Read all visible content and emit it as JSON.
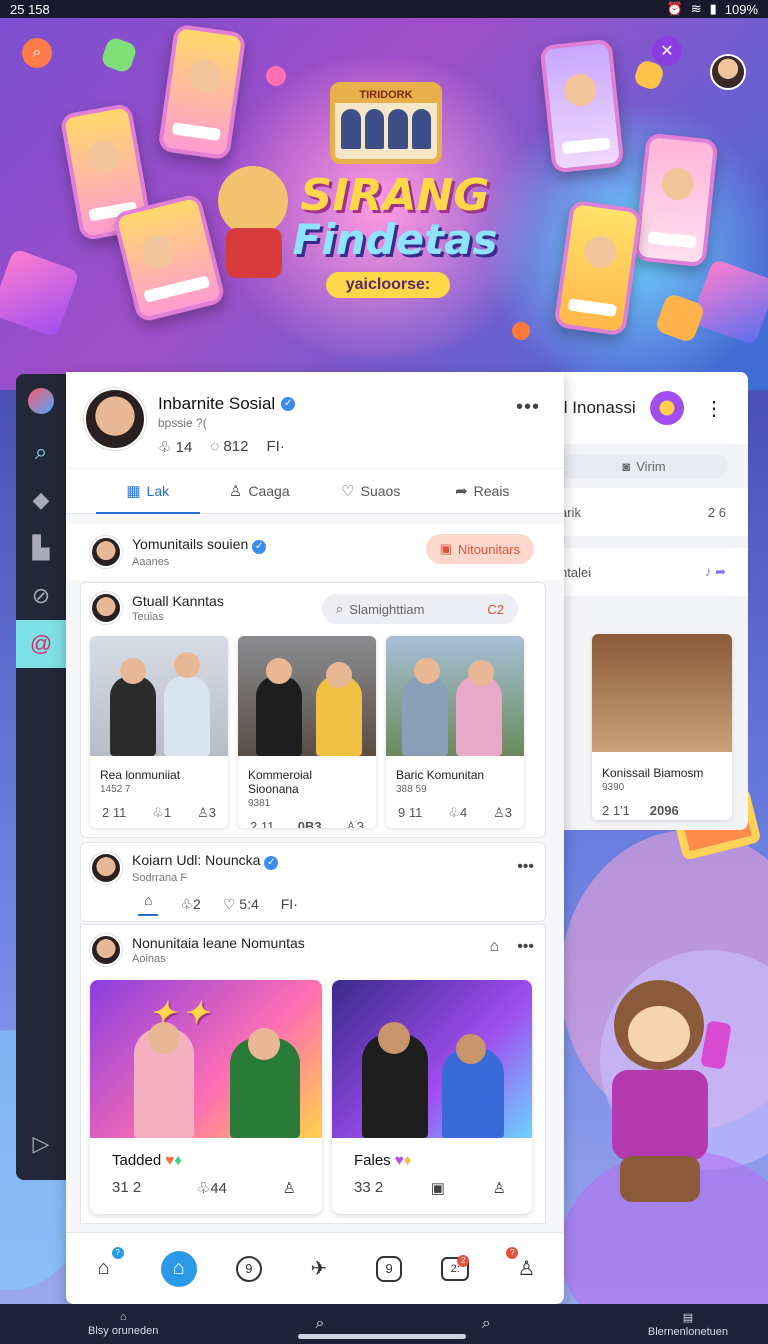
{
  "status": {
    "time": "25 158",
    "battery": "109%"
  },
  "hero": {
    "title_line1": "SIRANG",
    "title_line2": "Findetas",
    "badge": "yaicloorse:",
    "frame_label": "TIRIDORK"
  },
  "rail": {
    "items": [
      "logo-icon",
      "search-icon",
      "box-icon",
      "building-icon",
      "compass-icon",
      "at-icon",
      "play-icon"
    ]
  },
  "profile": {
    "name": "Inbarnite Sosial",
    "handle": "bpssie ?(",
    "stat1": "14",
    "stat2": "812",
    "stat3": "FI·"
  },
  "tabs": [
    {
      "label": "Lak",
      "icon": "▦"
    },
    {
      "label": "Caaga",
      "icon": "♙"
    },
    {
      "label": "Suaos",
      "icon": "♡"
    },
    {
      "label": "Reais",
      "icon": "➦"
    }
  ],
  "back_panel": {
    "title": "il Inonassi",
    "chip": "Virim",
    "row_left": "arik",
    "row_right": "2 6",
    "row2_left": "ntalei",
    "card_title": "Konissail Biamosm",
    "card_sub": "9390",
    "card_s1": "2 1'1",
    "card_s2": "2096"
  },
  "post1": {
    "title": "Yomunitails souien",
    "sub": "Aaanes",
    "pill": "Nitounitars"
  },
  "post2": {
    "title": "Gtuall Kanntas",
    "sub": "Teuias",
    "search": "Slamighttiam",
    "search_icon": "C2"
  },
  "minis": [
    {
      "caption": "Rea lonmuniiat",
      "sub": "1452 7",
      "s1": "2 11",
      "s2": "1",
      "s3": "3"
    },
    {
      "caption": "Kommeroial Sioonana",
      "sub": "9381",
      "s1": "2 11",
      "s2": "0B3",
      "s3": "3"
    },
    {
      "caption": "Baric Komunitan",
      "sub": "388 59",
      "s1": "9 11",
      "s2": "4",
      "s3": "3"
    }
  ],
  "post3": {
    "title": "Koiarn Udl: Nouncka",
    "sub": "Sodrrana F",
    "s1": "2",
    "s2": "5:4",
    "s3": "FI·"
  },
  "post4": {
    "title": "Nonunitaia leane Nomuntas",
    "sub": "Aoinas"
  },
  "bigs": [
    {
      "caption": "Tadded",
      "s1": "31 2",
      "s2": "44",
      "s3": ""
    },
    {
      "caption": "Fales",
      "s1": "33 2",
      "s2": "",
      "s3": ""
    }
  ],
  "bottomnav": [
    {
      "icon": "⌂",
      "badge": "?"
    },
    {
      "icon": "⌂",
      "badge": ""
    },
    {
      "icon": "9",
      "badge": ""
    },
    {
      "icon": "✈",
      "badge": ""
    },
    {
      "icon": "9",
      "badge": ""
    },
    {
      "icon": "2:",
      "badge": "2"
    },
    {
      "icon": "♙",
      "badge": "?"
    }
  ],
  "sysbar": {
    "left": "Blsy oruneden",
    "right": "Blernenlonetuen"
  },
  "colors": {
    "accent": "#2a6fd6",
    "pill_bg": "#fcd8cc",
    "pill_fg": "#e0523a",
    "rail_active": "#7fe0e6"
  }
}
